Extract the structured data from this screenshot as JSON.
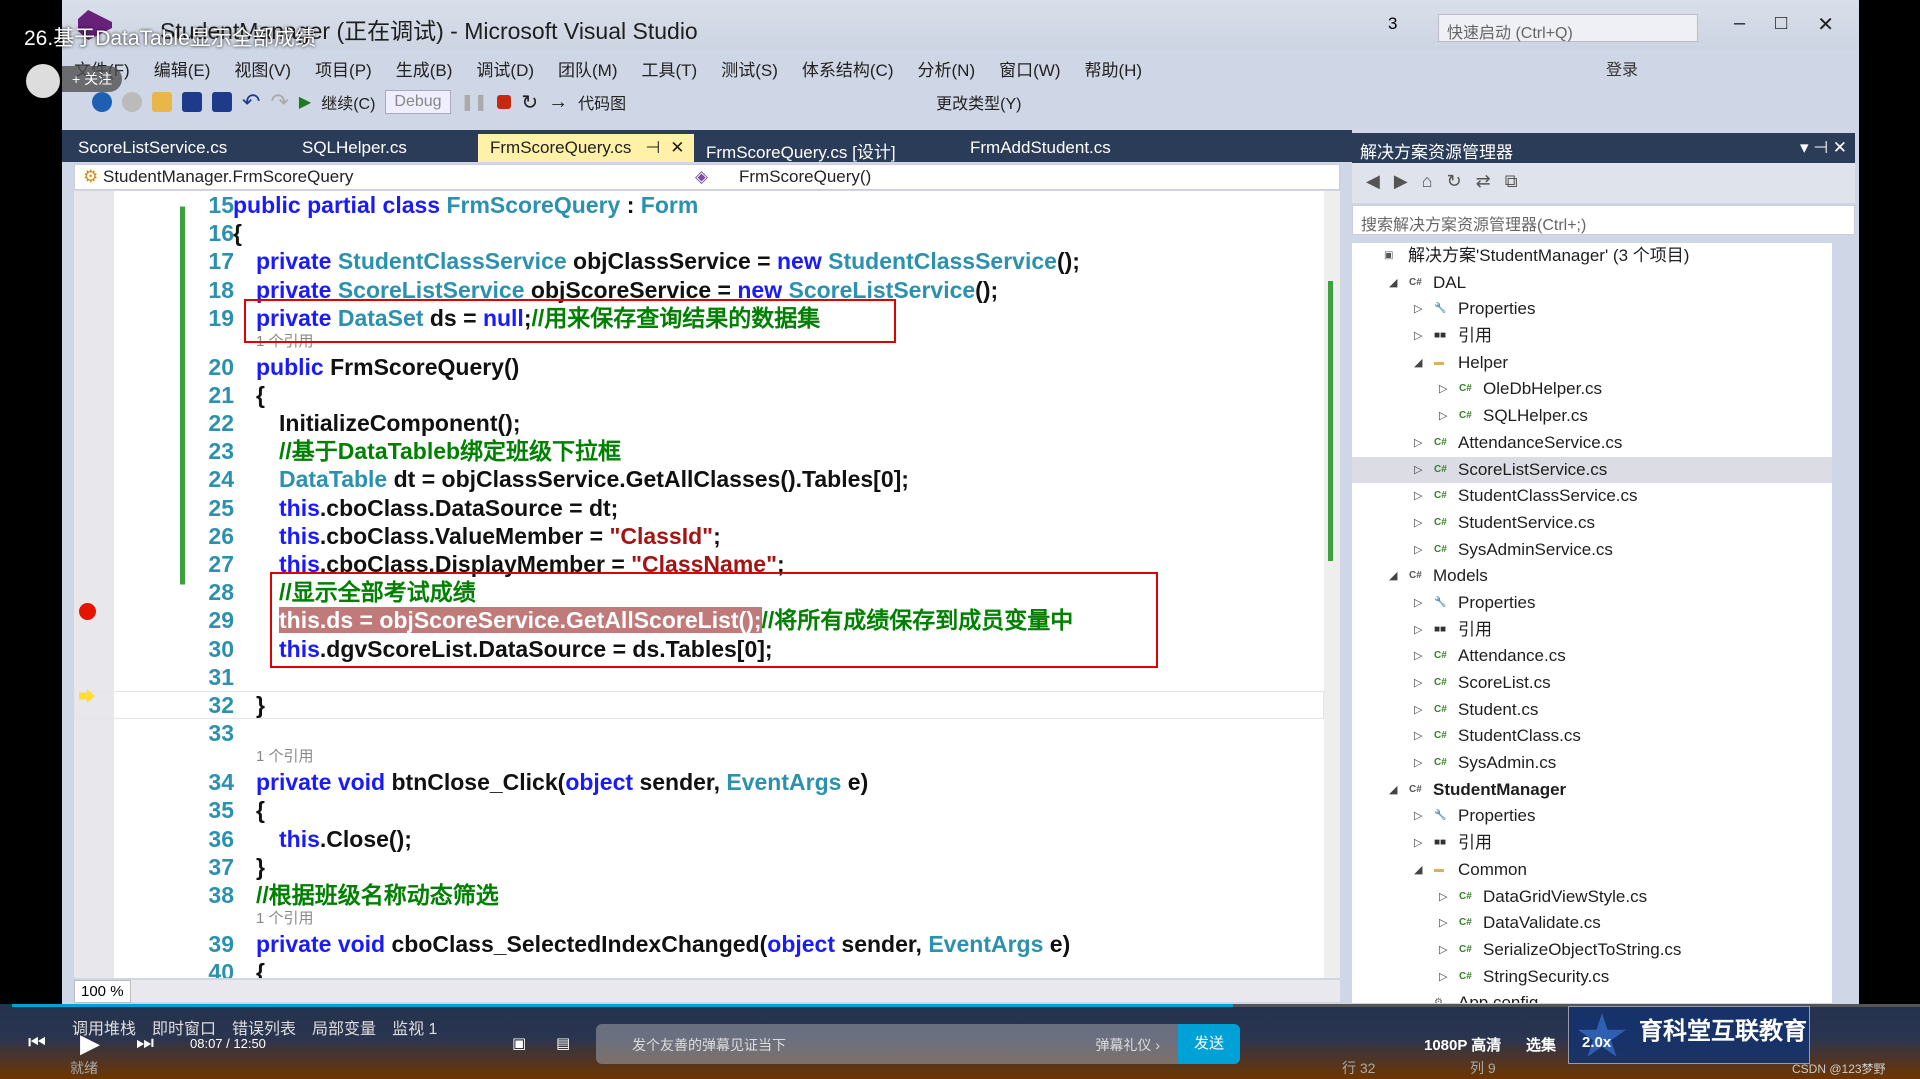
{
  "video": {
    "title": "26.基于DataTable显示全部成绩",
    "follow": "+ 关注",
    "time": "08:07 / 12:50",
    "progress_percent": 64,
    "quality": "1080P 高清",
    "episodes": "选集",
    "speed": "2.0x",
    "danmaku_placeholder": "发个友善的弹幕见证当下",
    "danmaku_etiquette": "弹幕礼仪 ›",
    "send": "发送",
    "watermark": "育科堂互联教育 xiketang.com",
    "credit": "CSDN @123梦野"
  },
  "window": {
    "title": "StudentManager (正在调试) - Microsoft Visual Studio",
    "quick_launch": "快速启动 (Ctrl+Q)",
    "notifications": "3",
    "login": "登录"
  },
  "menu": [
    "文件(F)",
    "编辑(E)",
    "视图(V)",
    "项目(P)",
    "生成(B)",
    "调试(D)",
    "团队(M)",
    "工具(T)",
    "测试(S)",
    "体系结构(C)",
    "分析(N)",
    "窗口(W)",
    "帮助(H)"
  ],
  "toolbar": {
    "continue": "继续(C)",
    "config": "Debug",
    "codemap": "代码图",
    "change_type": "更改类型(Y)"
  },
  "tabs": [
    {
      "label": "ScoreListService.cs"
    },
    {
      "label": "SQLHelper.cs"
    },
    {
      "label": "FrmScoreQuery.cs",
      "active": true
    },
    {
      "label": "FrmScoreQuery.cs [设计]"
    },
    {
      "label": "FrmAddStudent.cs"
    }
  ],
  "nav": {
    "class": "StudentManager.FrmScoreQuery",
    "member": "FrmScoreQuery()"
  },
  "editor": {
    "zoom": "100 %",
    "breakpoint_line": 29,
    "current_line": 32,
    "lines": [
      {
        "n": "15",
        "i": 0,
        "tok": [
          [
            "public partial class ",
            "k"
          ],
          [
            "FrmScoreQuery",
            "t"
          ],
          [
            " : ",
            "p"
          ],
          [
            "Form",
            "t"
          ]
        ]
      },
      {
        "n": "16",
        "i": 0,
        "tok": [
          [
            "{",
            "p"
          ]
        ]
      },
      {
        "n": "17",
        "i": 1,
        "tok": [
          [
            "private ",
            "k"
          ],
          [
            "StudentClassService",
            "t"
          ],
          [
            " objClassService = ",
            "p"
          ],
          [
            "new ",
            "k"
          ],
          [
            "StudentClassService",
            "t"
          ],
          [
            "();",
            "p"
          ]
        ]
      },
      {
        "n": "18",
        "i": 1,
        "tok": [
          [
            "private ",
            "k"
          ],
          [
            "ScoreListService",
            "t"
          ],
          [
            " objScoreService = ",
            "p"
          ],
          [
            "new ",
            "k"
          ],
          [
            "ScoreListService",
            "t"
          ],
          [
            "();",
            "p"
          ]
        ]
      },
      {
        "n": "19",
        "i": 1,
        "tok": [
          [
            "private ",
            "k"
          ],
          [
            "DataSet",
            "t"
          ],
          [
            " ds = ",
            "p"
          ],
          [
            "null",
            "k"
          ],
          [
            ";",
            "p"
          ],
          [
            "//用来保存查询结果的数据集",
            "c"
          ]
        ]
      },
      {
        "ref": "1 个引用",
        "i": 1
      },
      {
        "n": "20",
        "i": 1,
        "tok": [
          [
            "public ",
            "k"
          ],
          [
            "FrmScoreQuery()",
            "p"
          ]
        ]
      },
      {
        "n": "21",
        "i": 1,
        "tok": [
          [
            "{",
            "p"
          ]
        ]
      },
      {
        "n": "22",
        "i": 2,
        "tok": [
          [
            "InitializeComponent();",
            "p"
          ]
        ]
      },
      {
        "n": "23",
        "i": 2,
        "tok": [
          [
            "//基于DataTableb绑定班级下拉框",
            "c"
          ]
        ]
      },
      {
        "n": "24",
        "i": 2,
        "tok": [
          [
            "DataTable",
            "t"
          ],
          [
            " dt = objClassService.GetAllClasses().Tables[0];",
            "p"
          ]
        ]
      },
      {
        "n": "25",
        "i": 2,
        "tok": [
          [
            "this",
            "k"
          ],
          [
            ".cboClass.DataSource = dt;",
            "p"
          ]
        ]
      },
      {
        "n": "26",
        "i": 2,
        "tok": [
          [
            "this",
            "k"
          ],
          [
            ".cboClass.ValueMember = ",
            "p"
          ],
          [
            "\"ClassId\"",
            "s"
          ],
          [
            ";",
            "p"
          ]
        ]
      },
      {
        "n": "27",
        "i": 2,
        "tok": [
          [
            "this",
            "k"
          ],
          [
            ".cboClass.DisplayMember = ",
            "p"
          ],
          [
            "\"ClassName\"",
            "s"
          ],
          [
            ";",
            "p"
          ]
        ]
      },
      {
        "n": "28",
        "i": 2,
        "tok": [
          [
            "//显示全部考试成绩",
            "c"
          ]
        ]
      },
      {
        "n": "29",
        "i": 2,
        "tok": [
          [
            "this.ds = objScoreService.GetAllScoreList();",
            "hl"
          ],
          [
            "//将所有成绩保存到成员变量中",
            "c"
          ]
        ]
      },
      {
        "n": "30",
        "i": 2,
        "tok": [
          [
            "this",
            "k"
          ],
          [
            ".dgvScoreList.DataSource = ds.Tables[0];",
            "p"
          ]
        ]
      },
      {
        "n": "31",
        "i": 2,
        "tok": []
      },
      {
        "n": "32",
        "i": 1,
        "tok": [
          [
            "}",
            "p"
          ]
        ]
      },
      {
        "n": "33",
        "i": 1,
        "tok": []
      },
      {
        "ref": "1 个引用",
        "i": 1
      },
      {
        "n": "34",
        "i": 1,
        "tok": [
          [
            "private void ",
            "k"
          ],
          [
            "btnClose_Click(",
            "p"
          ],
          [
            "object ",
            "k"
          ],
          [
            "sender, ",
            "p"
          ],
          [
            "EventArgs",
            "t"
          ],
          [
            " e)",
            "p"
          ]
        ]
      },
      {
        "n": "35",
        "i": 1,
        "tok": [
          [
            "{",
            "p"
          ]
        ]
      },
      {
        "n": "36",
        "i": 2,
        "tok": [
          [
            "this",
            "k"
          ],
          [
            ".Close();",
            "p"
          ]
        ]
      },
      {
        "n": "37",
        "i": 1,
        "tok": [
          [
            "}",
            "p"
          ]
        ]
      },
      {
        "n": "38",
        "i": 1,
        "tok": [
          [
            "//根据班级名称动态筛选",
            "c"
          ]
        ]
      },
      {
        "ref": "1 个引用",
        "i": 1
      },
      {
        "n": "39",
        "i": 1,
        "tok": [
          [
            "private void ",
            "k"
          ],
          [
            "cboClass_SelectedIndexChanged(",
            "p"
          ],
          [
            "object ",
            "k"
          ],
          [
            "sender, ",
            "p"
          ],
          [
            "EventArgs",
            "t"
          ],
          [
            " e)",
            "p"
          ]
        ]
      },
      {
        "n": "40",
        "i": 1,
        "tok": [
          [
            "{",
            "p"
          ]
        ]
      }
    ]
  },
  "solution": {
    "title": "解决方案资源管理器",
    "search_placeholder": "搜索解决方案资源管理器(Ctrl+;)",
    "items": [
      {
        "l": 0,
        "e": "",
        "ic": "sln",
        "t": "解决方案'StudentManager' (3 个项目)"
      },
      {
        "l": 1,
        "e": "open",
        "ic": "proj",
        "t": "DAL"
      },
      {
        "l": 2,
        "e": "closed",
        "ic": "wrench",
        "t": "Properties"
      },
      {
        "l": 2,
        "e": "closed",
        "ic": "ref",
        "t": "引用"
      },
      {
        "l": 2,
        "e": "open",
        "ic": "folder",
        "t": "Helper"
      },
      {
        "l": 3,
        "e": "closed",
        "ic": "cs",
        "t": "OleDbHelper.cs"
      },
      {
        "l": 3,
        "e": "closed",
        "ic": "cs",
        "t": "SQLHelper.cs"
      },
      {
        "l": 2,
        "e": "closed",
        "ic": "cs",
        "t": "AttendanceService.cs"
      },
      {
        "l": 2,
        "e": "closed",
        "ic": "cs",
        "t": "ScoreListService.cs",
        "sel": true
      },
      {
        "l": 2,
        "e": "closed",
        "ic": "cs",
        "t": "StudentClassService.cs"
      },
      {
        "l": 2,
        "e": "closed",
        "ic": "cs",
        "t": "StudentService.cs"
      },
      {
        "l": 2,
        "e": "closed",
        "ic": "cs",
        "t": "SysAdminService.cs"
      },
      {
        "l": 1,
        "e": "open",
        "ic": "proj",
        "t": "Models"
      },
      {
        "l": 2,
        "e": "closed",
        "ic": "wrench",
        "t": "Properties"
      },
      {
        "l": 2,
        "e": "closed",
        "ic": "ref",
        "t": "引用"
      },
      {
        "l": 2,
        "e": "closed",
        "ic": "cs",
        "t": "Attendance.cs"
      },
      {
        "l": 2,
        "e": "closed",
        "ic": "cs",
        "t": "ScoreList.cs"
      },
      {
        "l": 2,
        "e": "closed",
        "ic": "cs",
        "t": "Student.cs"
      },
      {
        "l": 2,
        "e": "closed",
        "ic": "cs",
        "t": "StudentClass.cs"
      },
      {
        "l": 2,
        "e": "closed",
        "ic": "cs",
        "t": "SysAdmin.cs"
      },
      {
        "l": 1,
        "e": "open",
        "ic": "proj",
        "t": "StudentManager",
        "bold": true
      },
      {
        "l": 2,
        "e": "closed",
        "ic": "wrench",
        "t": "Properties"
      },
      {
        "l": 2,
        "e": "closed",
        "ic": "ref",
        "t": "引用"
      },
      {
        "l": 2,
        "e": "open",
        "ic": "folder",
        "t": "Common"
      },
      {
        "l": 3,
        "e": "closed",
        "ic": "cs",
        "t": "DataGridViewStyle.cs"
      },
      {
        "l": 3,
        "e": "closed",
        "ic": "cs",
        "t": "DataValidate.cs"
      },
      {
        "l": 3,
        "e": "closed",
        "ic": "cs",
        "t": "SerializeObjectToString.cs"
      },
      {
        "l": 3,
        "e": "closed",
        "ic": "cs",
        "t": "StringSecurity.cs"
      },
      {
        "l": 2,
        "e": "",
        "ic": "cfg",
        "t": "App.config"
      }
    ]
  },
  "bottom_tabs": [
    "调用堆栈",
    "即时窗口",
    "错误列表",
    "局部变量",
    "监视 1"
  ],
  "status": {
    "ready": "就绪",
    "row": "行 32",
    "col": "列 9"
  }
}
